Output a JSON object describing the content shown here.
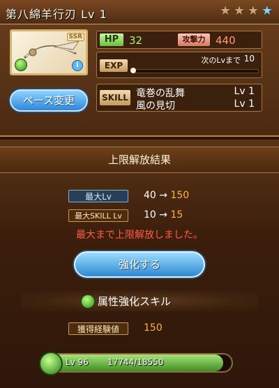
{
  "item": {
    "name": "第八綿羊行刃",
    "level": "Lv 1",
    "rarity_badge": "SSR",
    "info_glyph": "i",
    "stars": [
      {
        "icon": "star-icon"
      },
      {
        "icon": "star-icon"
      },
      {
        "icon": "star-icon"
      },
      {
        "icon": "star-blue-icon"
      }
    ]
  },
  "stats": {
    "hp_label": "HP",
    "hp_value": "32",
    "atk_label": "攻撃力",
    "atk_value": "440",
    "exp_label": "EXP",
    "next_label": "次のLvまで",
    "next_value": "10",
    "exp_fraction": 0.0
  },
  "base_button": "ベース変更",
  "skills": {
    "label": "SKILL",
    "items": [
      {
        "name": "竜巻の乱舞",
        "level": "Lv 1"
      },
      {
        "name": "風の見切",
        "level": "Lv 1"
      }
    ]
  },
  "result": {
    "title": "上限解放結果",
    "max_lv_label": "最大Lv",
    "max_lv_old": "40",
    "max_lv_new": "150",
    "max_skill_label": "最大SKILL Lv",
    "max_skill_old": "10",
    "max_skill_new": "15",
    "arrow": "→",
    "notice": "最大まで上限解放しました。",
    "strengthen_button": "強化する",
    "skill_section": "属性強化スキル",
    "exp_gain_label": "獲得経験値",
    "exp_gain_value": "150"
  },
  "player_level": {
    "lv_text": "Lv 96",
    "progress_text": "17744/18550",
    "fraction": 0.957
  },
  "colors": {
    "accent_blue": "#2c88d8",
    "element_green": "#2e8a1c",
    "notice_red": "#ff5c44",
    "value_orange": "#ffb347"
  }
}
